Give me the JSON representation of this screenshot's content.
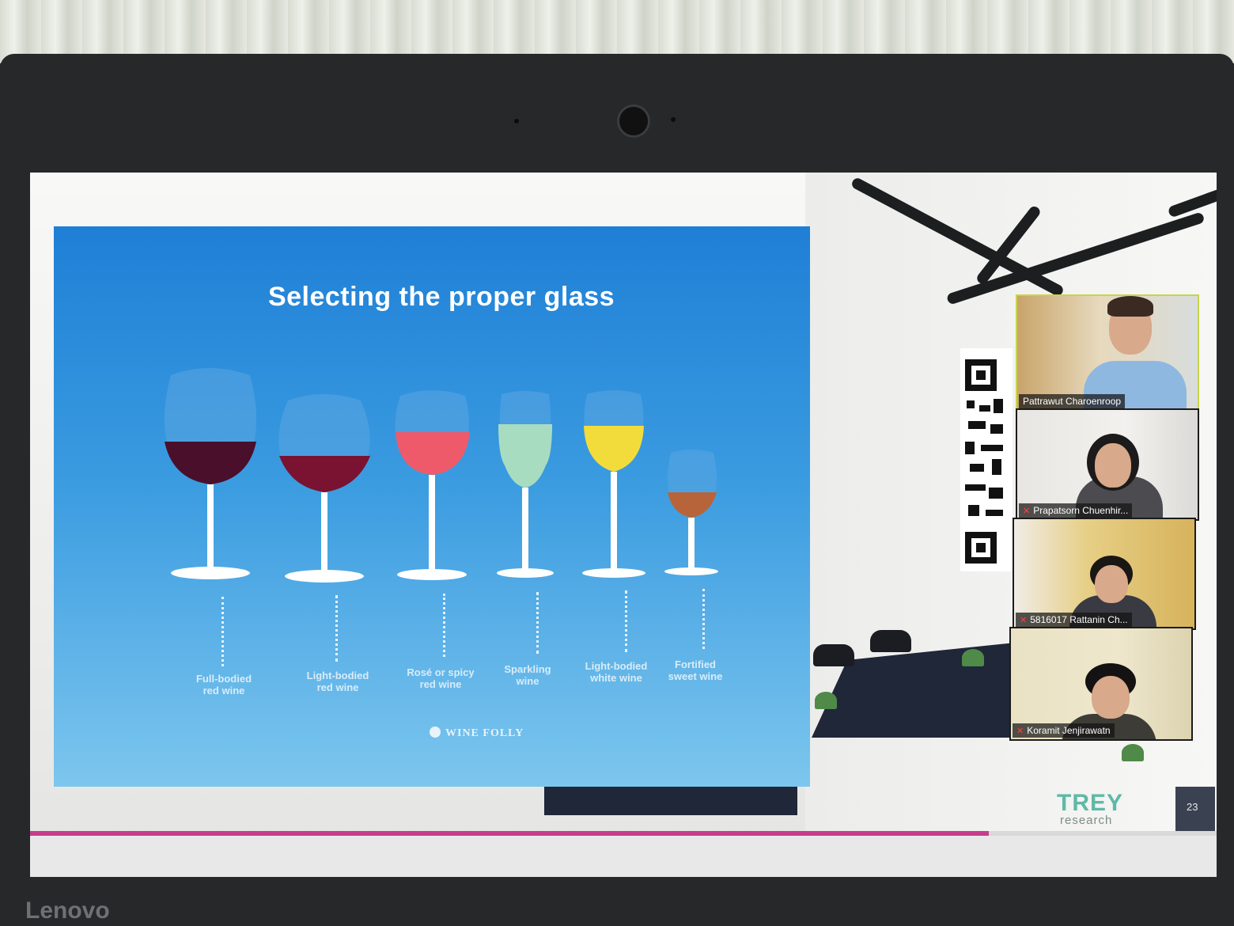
{
  "slide": {
    "title": "Selecting the proper glass",
    "brand": "WINE FOLLY",
    "glasses": [
      {
        "line1": "Full-bodied",
        "line2": "red wine",
        "wine_color": "#4a0f2a"
      },
      {
        "line1": "Light-bodied",
        "line2": "red wine",
        "wine_color": "#7a1232"
      },
      {
        "line1": "Rosé or spicy",
        "line2": "red wine",
        "wine_color": "#ef5a6a"
      },
      {
        "line1": "Sparkling",
        "line2": "wine",
        "wine_color": "#a8dcc0"
      },
      {
        "line1": "Light-bodied",
        "line2": "white wine",
        "wine_color": "#f2dc3c"
      },
      {
        "line1": "Fortified",
        "line2": "sweet wine",
        "wine_color": "#b8643a"
      }
    ],
    "page_number": "23"
  },
  "presenter_brand": {
    "name": "TREY",
    "subtitle": "research"
  },
  "participants": [
    {
      "name": "Pattrawut Charoenroop",
      "muted": false
    },
    {
      "name": "Prapatsorn Chuenhir...",
      "muted": true
    },
    {
      "name": "5816017 Rattanin Ch...",
      "muted": true
    },
    {
      "name": "Koramit Jenjirawatn",
      "muted": true
    }
  ],
  "laptop": {
    "brand": "Lenovo"
  },
  "colors": {
    "slide_top": "#1f7fd6",
    "slide_bottom": "#7cc6ee",
    "accent_bar": "#c83c8c",
    "trey_green": "#5fb9a6"
  }
}
